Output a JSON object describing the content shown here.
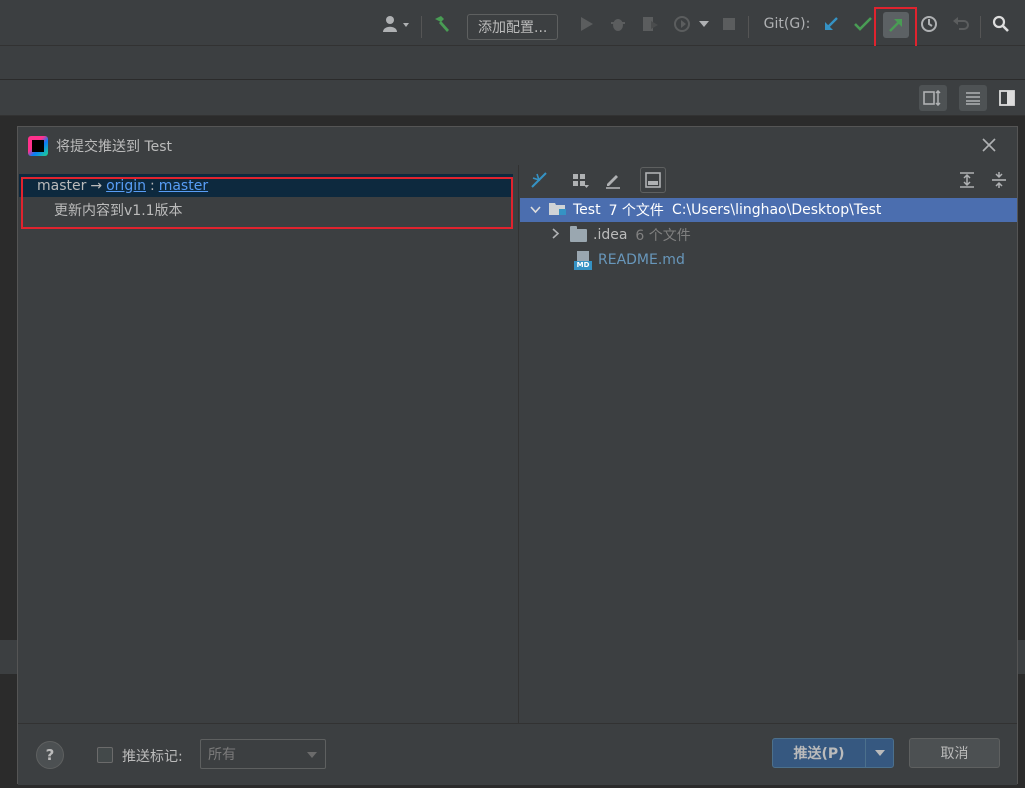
{
  "toolbar": {
    "add_config_label": "添加配置...",
    "git_label": "Git(G):"
  },
  "dialog": {
    "title": "将提交推送到 Test",
    "close_icon": "close-icon",
    "left": {
      "branch_local": "master",
      "arrow": "→",
      "remote": "origin",
      "colon": ":",
      "remote_branch": "master",
      "commit_message": "更新内容到v1.1版本"
    },
    "right": {
      "root_name": "Test",
      "root_count": "7 个文件",
      "root_path": "C:\\Users\\linghao\\Desktop\\Test",
      "folder_name": ".idea",
      "folder_count": "6 个文件",
      "file_name": "README.md",
      "file_badge": "MD"
    },
    "footer": {
      "help": "?",
      "push_tags_label": "推送标记:",
      "tags_select_value": "所有",
      "push_button": "推送(P)",
      "cancel_button": "取消"
    }
  },
  "colors": {
    "accent_selection": "#4b6eaf",
    "highlight_frame": "#e0232e",
    "link": "#589df6",
    "git_update": "#3592c4",
    "git_commit": "#499c54"
  }
}
